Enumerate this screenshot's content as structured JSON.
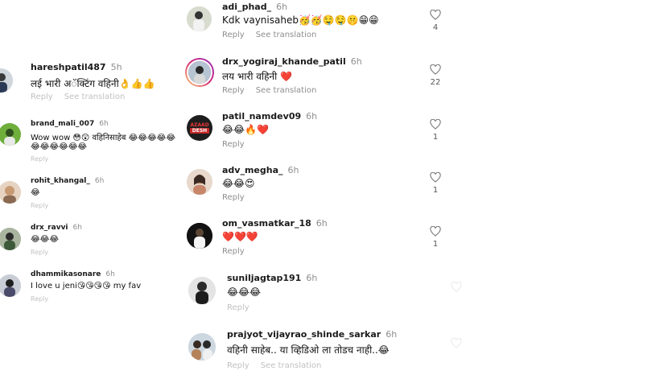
{
  "left_comments": [
    {
      "user": "hareshpatil487",
      "time": "5h",
      "text": "लई भारी अॅक्टिंग वहिनी👌👍👍",
      "reply": "Reply",
      "see_translation": "See translation"
    },
    {
      "user": "brand_mali_007",
      "time": "6h",
      "text_line1": "Wow wow 😳😲 वहिनिसाहेब 😂😂😂😂😂",
      "text_line2": "😂😂😂😂😂😂",
      "reply": "Reply"
    },
    {
      "user": "rohit_khangal_",
      "time": "6h",
      "text": "😂",
      "reply": "Reply"
    },
    {
      "user": "drx_ravvi",
      "time": "6h",
      "text": "😂😂😂",
      "reply": "Reply"
    },
    {
      "user": "dhammikasonare",
      "time": "6h",
      "text": "I love u jeni😘😘😘😘 my fav",
      "reply": "Reply"
    }
  ],
  "right_comments": [
    {
      "user": "adi_phad_",
      "time": "6h",
      "text": "Kdk vaynisaheb🥳🥳🤤🤤🤫😁😁",
      "reply": "Reply",
      "see_translation": "See translation",
      "likes": "4"
    },
    {
      "user": "drx_yogiraj_khande_patil",
      "time": "6h",
      "text": "लय भारी वहिनी ❤️",
      "reply": "Reply",
      "see_translation": "See translation",
      "likes": "22"
    },
    {
      "user": "patil_namdev09",
      "time": "6h",
      "text": "😂😂🔥❤️",
      "reply": "Reply",
      "likes": "1",
      "avatar_text_1": "AZAAD",
      "avatar_text_2": "DESH"
    },
    {
      "user": "adv_megha_",
      "time": "6h",
      "text": "😂😂😍",
      "reply": "Reply",
      "likes": "1"
    },
    {
      "user": "om_vasmatkar_18",
      "time": "6h",
      "text": "❤️❤️❤️",
      "reply": "Reply",
      "likes": "1"
    },
    {
      "user": "suniljagtap191",
      "time": "6h",
      "text": "😂😂😂",
      "reply": "Reply"
    },
    {
      "user": "prajyot_vijayrao_shinde_sarkar",
      "time": "6h",
      "text": "वहिनी साहेब.. या व्हिडिओ ला तोडच नाही..😂",
      "reply": "Reply",
      "see_translation": "See translation"
    }
  ],
  "icons": {
    "like": "heart-outline-icon"
  },
  "colors": {
    "text": "#111111",
    "muted": "#8e8e8e",
    "heart_stroke": "#737373",
    "story_ring": "#c13584"
  }
}
